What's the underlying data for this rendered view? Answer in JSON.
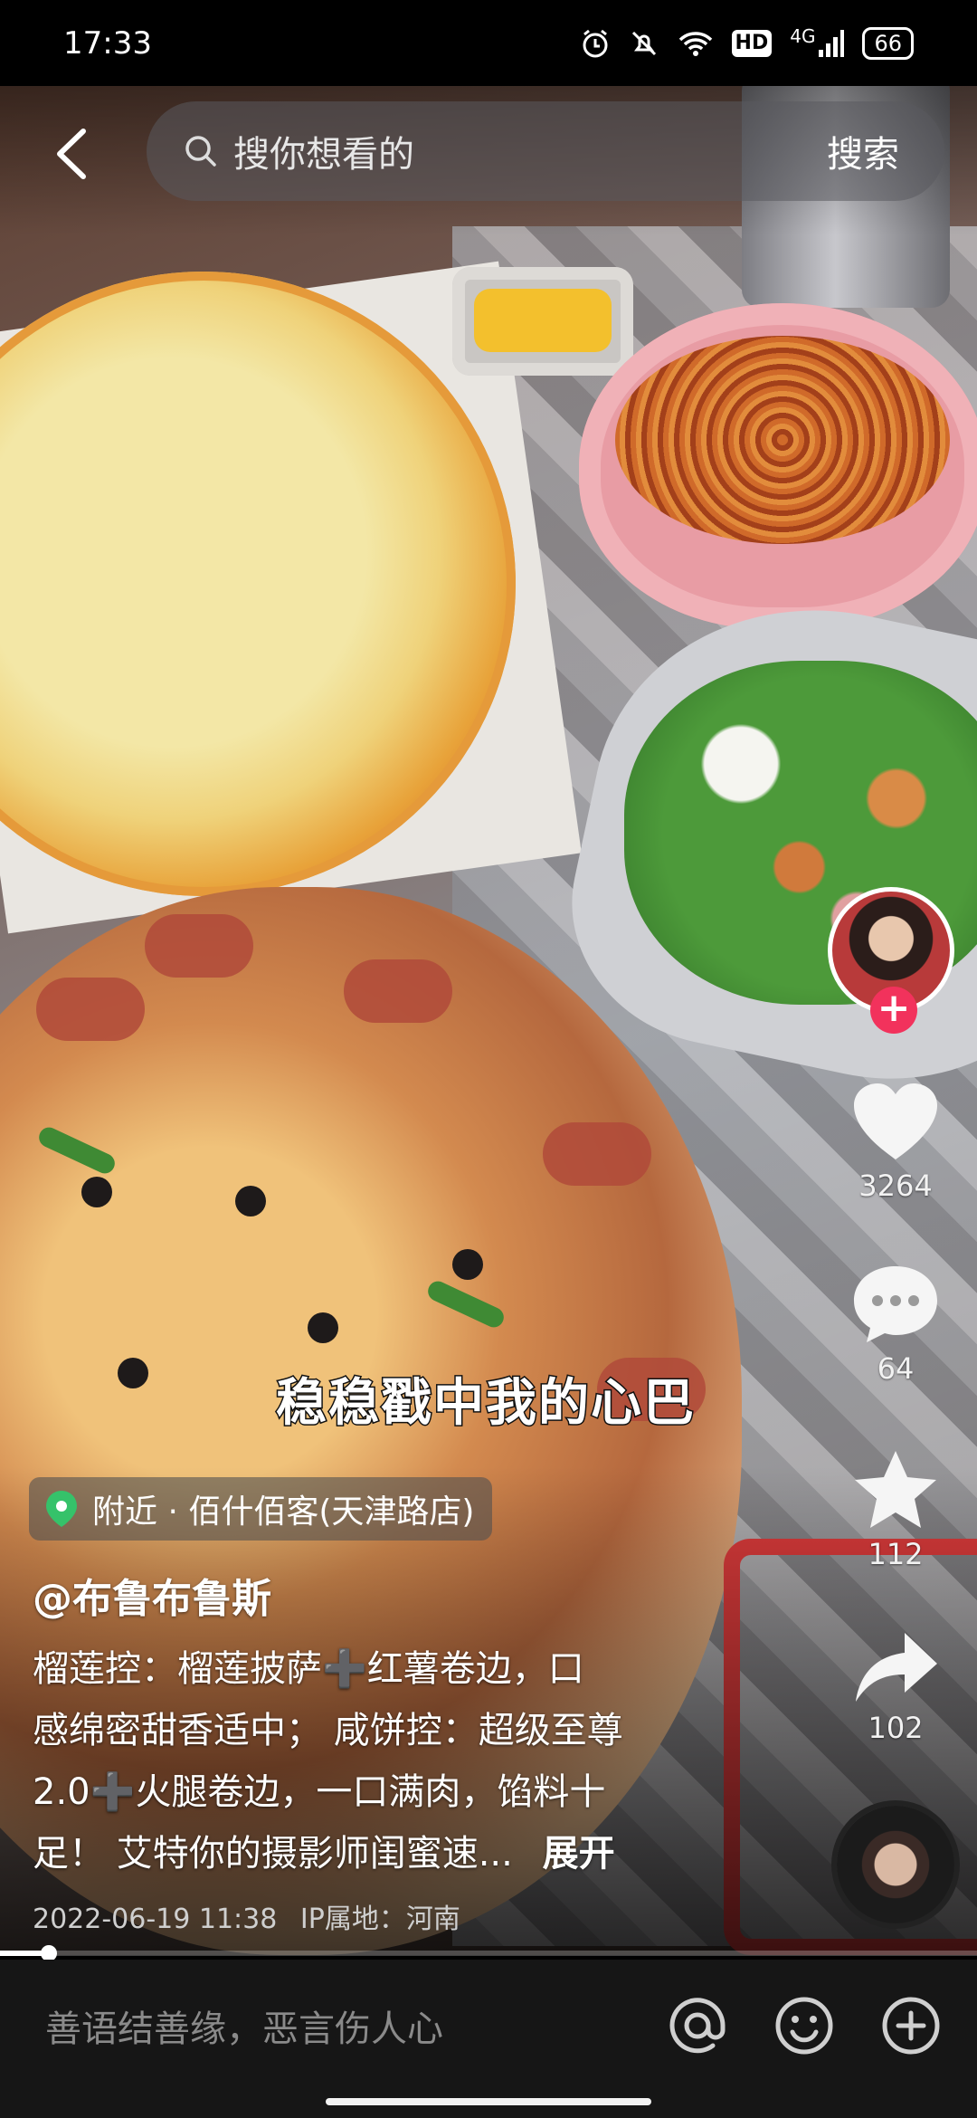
{
  "status_bar": {
    "time": "17:33",
    "network": "4G",
    "hd_label": "HD",
    "battery": "66",
    "icons": [
      "alarm-icon",
      "mute-icon",
      "wifi-icon",
      "hd-icon",
      "signal-icon",
      "battery-icon"
    ]
  },
  "header": {
    "search_placeholder": "搜你想看的",
    "search_button": "搜索"
  },
  "video": {
    "overlay_caption": "稳稳戳中我的心巴",
    "progress_fraction": 0.05
  },
  "actions": {
    "likes": "3264",
    "comments": "64",
    "favorites": "112",
    "shares": "102"
  },
  "post": {
    "location": "附近 · 佰什佰客(天津路店)",
    "author": "@布鲁布鲁斯",
    "description_lines": [
      "榴莲控：榴莲披萨➕红薯卷边，口",
      "感绵密甜香适中； 咸饼控：超级至尊",
      "2.0➕火腿卷边，一口满肉，馅料十",
      "足！ 艾特你的摄影师闺蜜速..."
    ],
    "expand_label": "展开",
    "date": "2022-06-19 11:38",
    "ip_location": "IP属地：河南"
  },
  "comment_bar": {
    "placeholder": "善语结善缘，恶言伤人心"
  },
  "colors": {
    "like_red": "#f2325c",
    "bar_bg": "#161616"
  }
}
